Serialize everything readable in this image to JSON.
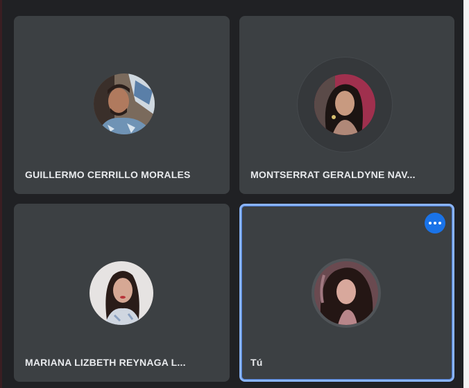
{
  "participants": [
    {
      "name": "GUILLERMO CERRILLO MORALES"
    },
    {
      "name": "MONTSERRAT GERALDYNE NAV..."
    },
    {
      "name": "MARIANA LIZBETH REYNAGA L..."
    },
    {
      "name": "Tú"
    }
  ],
  "icons": {
    "more_options": "more-horiz-icon"
  },
  "colors": {
    "background": "#202124",
    "tile": "#3c4043",
    "active_border": "#8ab4f8",
    "more_button": "#1a73e8",
    "name_text": "#e8eaed"
  }
}
